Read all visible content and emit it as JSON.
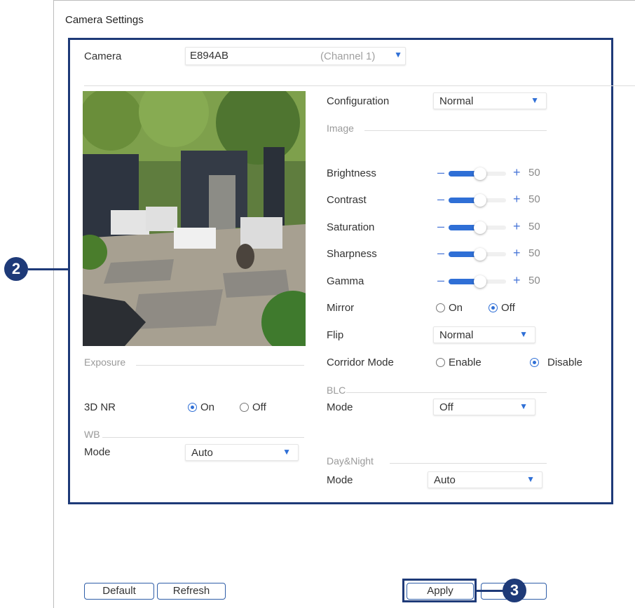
{
  "title": "Camera Settings",
  "camera": {
    "label": "Camera",
    "value": "E894AB",
    "channel": "(Channel 1)"
  },
  "config": {
    "label": "Configuration",
    "value": "Normal"
  },
  "image_section": "Image",
  "sliders": [
    {
      "label": "Brightness",
      "value": "50"
    },
    {
      "label": "Contrast",
      "value": "50"
    },
    {
      "label": "Saturation",
      "value": "50"
    },
    {
      "label": "Sharpness",
      "value": "50"
    },
    {
      "label": "Gamma",
      "value": "50"
    }
  ],
  "slider_symbols": {
    "minus": "–",
    "plus": "+"
  },
  "mirror": {
    "label": "Mirror",
    "on": "On",
    "off": "Off",
    "selected": "Off"
  },
  "flip": {
    "label": "Flip",
    "value": "Normal"
  },
  "corridor": {
    "label": "Corridor Mode",
    "enable": "Enable",
    "disable": "Disable",
    "selected": "Disable"
  },
  "exposure_section": "Exposure",
  "nr3d": {
    "label": "3D NR",
    "on": "On",
    "off": "Off",
    "selected": "On"
  },
  "wb": {
    "section": "WB",
    "mode_label": "Mode",
    "value": "Auto"
  },
  "blc": {
    "section": "BLC",
    "mode_label": "Mode",
    "value": "Off"
  },
  "daynight": {
    "section": "Day&Night",
    "mode_label": "Mode",
    "value": "Auto"
  },
  "buttons": {
    "default": "Default",
    "refresh": "Refresh",
    "apply": "Apply"
  },
  "callouts": {
    "two": "2",
    "three": "3"
  },
  "icons": {
    "dropdown": "chevron-down-icon"
  },
  "colors": {
    "accent": "#2f6fd6",
    "callout": "#1e3a78"
  }
}
